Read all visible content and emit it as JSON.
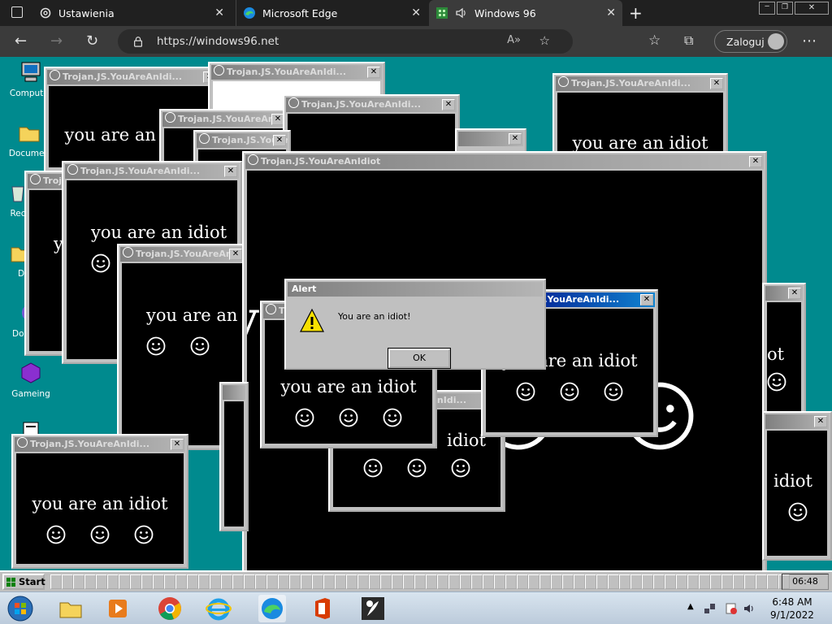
{
  "browser": {
    "tabs": [
      {
        "label": "Ustawienia",
        "icon": "gear-icon"
      },
      {
        "label": "Microsoft Edge",
        "icon": "edge-icon"
      },
      {
        "label": "Windows 96",
        "icon": "windows96-icon"
      }
    ],
    "url": "https://windows96.net",
    "login_label": "Zaloguj"
  },
  "desktop": {
    "icons": [
      {
        "label": "Computer"
      },
      {
        "label": "Documen"
      },
      {
        "label": "Rec"
      },
      {
        "label": "D"
      },
      {
        "label": "Doordisc"
      },
      {
        "label": "Gameing"
      }
    ]
  },
  "windows": {
    "title": "Trojan.JS.YouAreAnIdiot",
    "title_short": "Trojan.JS.YouAreAnIdi...",
    "message": "you are an idiot"
  },
  "alert": {
    "title": "Alert",
    "message": "You are an idiot!",
    "ok_label": "OK"
  },
  "w96_taskbar": {
    "start_label": "Start",
    "clock": "06:48"
  },
  "win7_taskbar": {
    "time": "6:48 AM",
    "date": "9/1/2022"
  }
}
